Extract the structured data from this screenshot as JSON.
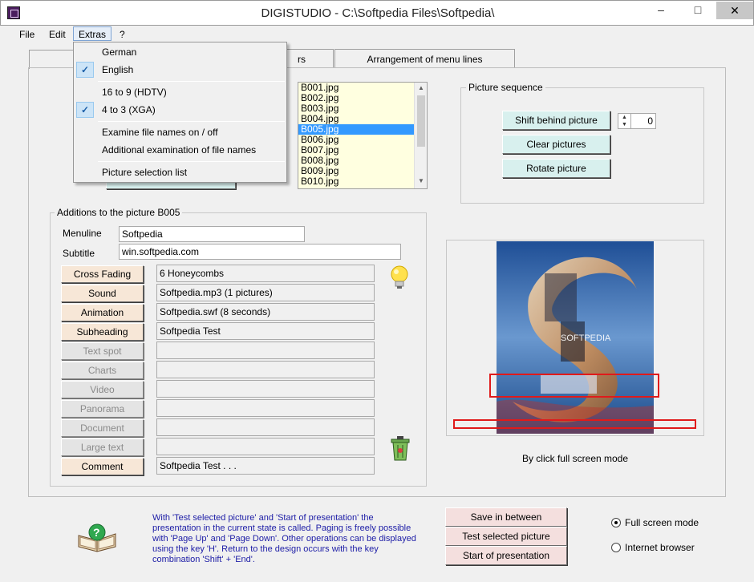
{
  "window": {
    "title": "DIGISTUDIO - C:\\Softpedia Files\\Softpedia\\",
    "minimize": "–",
    "maximize": "□",
    "close": "✕"
  },
  "menubar": {
    "file": "File",
    "edit": "Edit",
    "extras": "Extras",
    "help": "?"
  },
  "extras_menu": {
    "german": "German",
    "english": "English",
    "hdtv": "16 to 9 (HDTV)",
    "xga": "4 to 3 (XGA)",
    "examine": "Examine file names on / off",
    "additional": "Additional examination of file names",
    "selection_list": "Picture selection list",
    "checked_items": [
      "English",
      "4 to 3 (XGA)"
    ]
  },
  "tabs": {
    "hidden_label": "rs",
    "arrangement": "Arrangement of menu lines"
  },
  "picture_list": {
    "items": [
      "B001.jpg",
      "B002.jpg",
      "B003.jpg",
      "B004.jpg",
      "B005.jpg",
      "B006.jpg",
      "B007.jpg",
      "B008.jpg",
      "B009.jpg",
      "B010.jpg"
    ],
    "selected": "B005.jpg"
  },
  "picture_sequence": {
    "legend": "Picture sequence",
    "shift": "Shift behind picture",
    "shift_value": "0",
    "clear": "Clear pictures",
    "rotate": "Rotate picture"
  },
  "additions": {
    "legend": "Additions to the picture B005",
    "menuline_label": "Menuline",
    "menuline_value": "Softpedia",
    "subtitle_label": "Subtitle",
    "subtitle_value": "win.softpedia.com",
    "rows": [
      {
        "label": "Cross Fading",
        "value": "6 Honeycombs",
        "enabled": true
      },
      {
        "label": "Sound",
        "value": "Softpedia.mp3   (1 pictures)",
        "enabled": true
      },
      {
        "label": "Animation",
        "value": "Softpedia.swf   (8 seconds)",
        "enabled": true
      },
      {
        "label": "Subheading",
        "value": "Softpedia Test",
        "enabled": true
      },
      {
        "label": "Text spot",
        "value": "",
        "enabled": false
      },
      {
        "label": "Charts",
        "value": "",
        "enabled": false
      },
      {
        "label": "Video",
        "value": "",
        "enabled": false
      },
      {
        "label": "Panorama",
        "value": "",
        "enabled": false
      },
      {
        "label": "Document",
        "value": "",
        "enabled": false
      },
      {
        "label": "Large text",
        "value": "",
        "enabled": false
      },
      {
        "label": "Comment",
        "value": "Softpedia Test . . .",
        "enabled": true
      }
    ]
  },
  "preview": {
    "caption": "By click full screen mode",
    "watermark": "SOFTPEDIA"
  },
  "info_text": "With 'Test selected picture' and 'Start of presentation' the presentation in the current state is called. Paging is freely possible with 'Page Up' and 'Page Down'. Other operations can be displayed using the key 'H'. Return to the design occurs with the key combination 'Shift' + 'End'.",
  "actions": {
    "save": "Save in between",
    "test": "Test selected picture",
    "start": "Start of presentation"
  },
  "mode": {
    "full_screen": "Full screen mode",
    "browser": "Internet browser",
    "selected": "Full screen mode"
  },
  "colors": {
    "accent_teal": "#d8f0ee",
    "accent_pink": "#f4dfde",
    "list_bg": "#ffffe0",
    "selection": "#3399ff",
    "info_text": "#1c1ca6"
  }
}
